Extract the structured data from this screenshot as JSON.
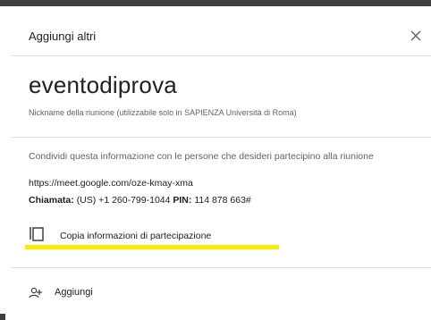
{
  "dialog": {
    "title": "Aggiungi altri",
    "close_icon": "close-icon"
  },
  "meeting": {
    "name": "eventodiprova",
    "nickname_hint": "Nickname della riunione (utilizzabile solo in SAPIENZA Università di Roma)"
  },
  "join_info": {
    "share_text": "Condividi questa informazione con le persone che desideri partecipino alla riunione",
    "url": "https://meet.google.com/oze-kmay-xma",
    "call_label": "Chiamata:",
    "call_number": "(US) +1 260-799-1044",
    "pin_label": "PIN:",
    "pin_value": "114 878 663#"
  },
  "actions": {
    "copy_icon": "copy-icon",
    "copy_label": "Copia informazioni di partecipazione",
    "add_icon": "add-person-icon",
    "add_label": "Aggiungi"
  },
  "colors": {
    "highlight": "#ffeb00",
    "divider": "#e0e0e0",
    "secondary_text": "#5f6368"
  }
}
